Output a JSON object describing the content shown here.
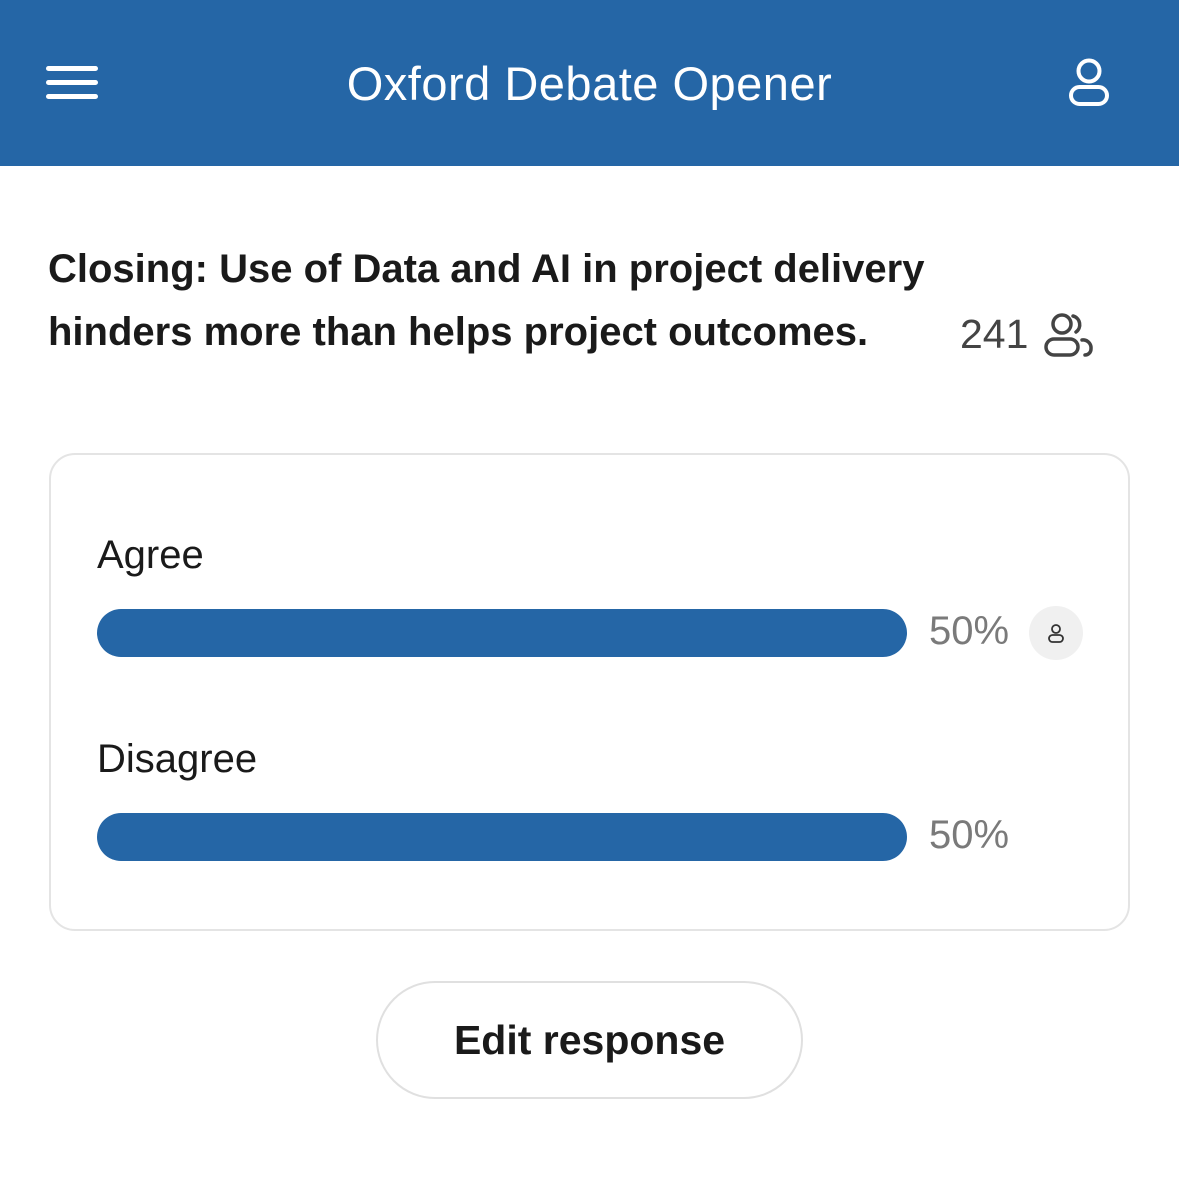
{
  "header": {
    "title": "Oxford Debate Opener",
    "menu_icon": "hamburger-menu-icon",
    "profile_icon": "user-icon",
    "background_color": "#2566a6"
  },
  "poll": {
    "question": "Closing: Use of Data and AI in project delivery hinders more than helps project outcomes.",
    "participants_count": "241",
    "participants_icon": "users-group-icon",
    "options": [
      {
        "label": "Agree",
        "percent_text": "50%",
        "percent": 50,
        "selected_by_user": true
      },
      {
        "label": "Disagree",
        "percent_text": "50%",
        "percent": 50,
        "selected_by_user": false
      }
    ],
    "bar_color": "#2566a6"
  },
  "actions": {
    "edit_label": "Edit response"
  }
}
